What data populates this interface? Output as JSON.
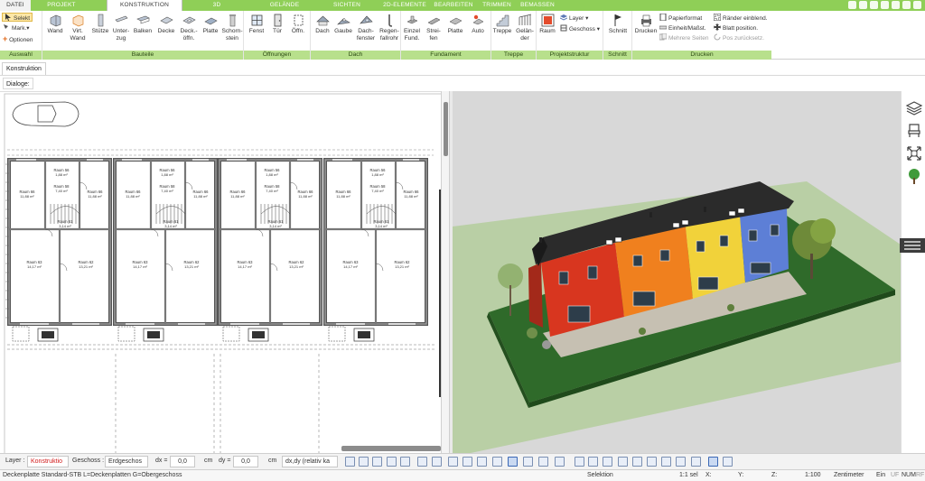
{
  "tabs": [
    {
      "label": "DATEI"
    },
    {
      "label": "PROJEKT"
    },
    {
      "label": "KONSTRUKTION"
    },
    {
      "label": "3D"
    },
    {
      "label": "GELÄNDE"
    },
    {
      "label": "SICHTEN"
    },
    {
      "label": "2D-ELEMENTE"
    },
    {
      "label": "BEARBEITEN"
    },
    {
      "label": "TRIMMEN"
    },
    {
      "label": "BEMASSEN"
    }
  ],
  "active_tab": "KONSTRUKTION",
  "ribbon": {
    "auswahl": {
      "label": "Auswahl",
      "select": "Selekt",
      "mark": "Mark.",
      "options": "Optionen"
    },
    "bauteile": {
      "label": "Bauteile",
      "items": [
        "Wand",
        "Virt. Wand",
        "Stütze",
        "Unter-zug",
        "Balken",
        "Decke",
        "Deck.-öffn.",
        "Platte",
        "Schorn-stein"
      ]
    },
    "oeffnungen": {
      "label": "Öffnungen",
      "items": [
        "Fenst",
        "Tür",
        "Öffn."
      ]
    },
    "dach": {
      "label": "Dach",
      "items": [
        "Dach",
        "Gaube",
        "Dach-fenster",
        "Regen-fallrohr"
      ]
    },
    "fundament": {
      "label": "Fundament",
      "items": [
        "Einzel Fund.",
        "Strei-fen",
        "Platte",
        "Auto"
      ]
    },
    "treppe": {
      "label": "Treppe",
      "items": [
        "Treppe",
        "Gelän-der"
      ]
    },
    "projektstruktur": {
      "label": "Projektstruktur",
      "raum": "Raum",
      "layer": "Layer",
      "geschoss": "Geschoss"
    },
    "schnitt": {
      "label": "Schnitt",
      "item": "Schnitt"
    },
    "drucken": {
      "label": "Drucken",
      "print": "Drucken",
      "papierformat": "Papierformat",
      "einheit": "Einheit/Maßst.",
      "mehrere": "Mehrere Seiten",
      "raender": "Ränder einblend.",
      "blatt": "Blatt position.",
      "pos": "Pos zurücksetz."
    }
  },
  "konstruktion_tab": "Konstruktion",
  "dialoge_label": "Dialoge:",
  "plan_rooms": [
    {
      "name": "Raum 56",
      "area": "1,88 m²"
    },
    {
      "name": "Raum 58",
      "area": "7,40 m²"
    },
    {
      "name": "Raum 66",
      "area": "11,88 m²"
    },
    {
      "name": "Raum 61",
      "area": "3,14 m²"
    },
    {
      "name": "Raum 63",
      "area": "14,17 m²"
    },
    {
      "name": "Raum 62",
      "area": "13,21 m²"
    }
  ],
  "bottom": {
    "layer_label": "Layer :",
    "layer_value": "Konstruktio",
    "geschoss_label": "Geschoss :",
    "geschoss_value": "Erdgeschos",
    "dx_label": "dx =",
    "dx_value": "0,0",
    "dx_unit": "cm",
    "dy_label": "dy =",
    "dy_value": "0,0",
    "dy_unit": "cm",
    "mode": "dx,dy (relativ ka"
  },
  "status": {
    "info": "Deckenplatte Standard-STB L=Deckenplatten G=Obergeschoss",
    "mode": "Selektion",
    "sel": "1:1 sel",
    "x": "X:",
    "y": "Y:",
    "z": "Z:",
    "scale": "1:100",
    "unit": "Zentimeter",
    "ein": "Ein",
    "uf": "UF",
    "num": "NUM",
    "rf": "RF"
  },
  "colors": {
    "accent": "#8fcf57",
    "ribbon_label": "#b8e08c",
    "grass": "#2f6a2a",
    "roof": "#2b2b2b",
    "house_red": "#d8361f",
    "house_orange": "#f0801e",
    "house_yellow": "#f1d23a",
    "house_blue": "#5d7fd6"
  }
}
